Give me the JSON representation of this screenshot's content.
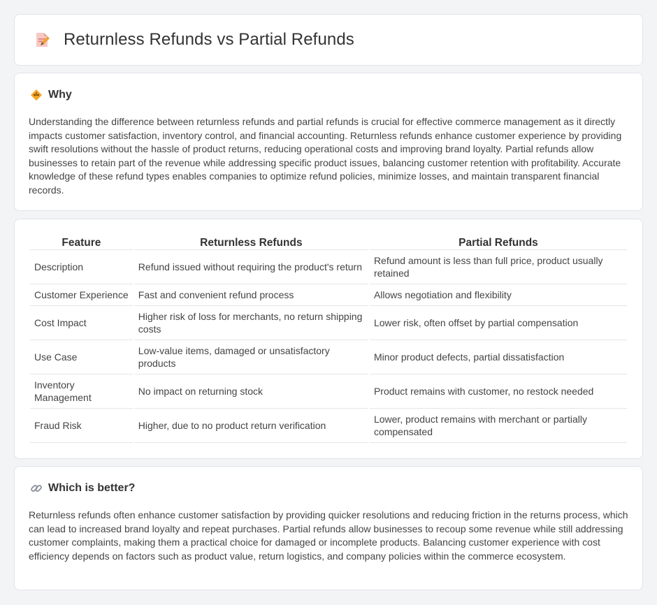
{
  "page": {
    "title": "Returnless Refunds vs Partial Refunds"
  },
  "why": {
    "icon": "diamond-warning-icon",
    "heading": "Why",
    "body": "Understanding the difference between returnless refunds and partial refunds is crucial for effective commerce management as it directly impacts customer satisfaction, inventory control, and financial accounting. Returnless refunds enhance customer experience by providing swift resolutions without the hassle of product returns, reducing operational costs and improving brand loyalty. Partial refunds allow businesses to retain part of the revenue while addressing specific product issues, balancing customer retention with profitability. Accurate knowledge of these refund types enables companies to optimize refund policies, minimize losses, and maintain transparent financial records."
  },
  "table": {
    "headers": [
      "Feature",
      "Returnless Refunds",
      "Partial Refunds"
    ],
    "rows": [
      [
        "Description",
        "Refund issued without requiring the product's return",
        "Refund amount is less than full price, product usually retained"
      ],
      [
        "Customer Experience",
        "Fast and convenient refund process",
        "Allows negotiation and flexibility"
      ],
      [
        "Cost Impact",
        "Higher risk of loss for merchants, no return shipping costs",
        "Lower risk, often offset by partial compensation"
      ],
      [
        "Use Case",
        "Low-value items, damaged or unsatisfactory products",
        "Minor product defects, partial dissatisfaction"
      ],
      [
        "Inventory Management",
        "No impact on returning stock",
        "Product remains with customer, no restock needed"
      ],
      [
        "Fraud Risk",
        "Higher, due to no product return verification",
        "Lower, product remains with merchant or partially compensated"
      ]
    ]
  },
  "better": {
    "icon": "link-icon",
    "heading": "Which is better?",
    "body": "Returnless refunds often enhance customer satisfaction by providing quicker resolutions and reducing friction in the returns process, which can lead to increased brand loyalty and repeat purchases. Partial refunds allow businesses to recoup some revenue while still addressing customer complaints, making them a practical choice for damaged or incomplete products. Balancing customer experience with cost efficiency depends on factors such as product value, return logistics, and company policies within the commerce ecosystem."
  },
  "colors": {
    "background": "#f3f4f6",
    "card": "#ffffff",
    "border": "#e2e4e8",
    "accent_orange": "#f0a03c"
  }
}
